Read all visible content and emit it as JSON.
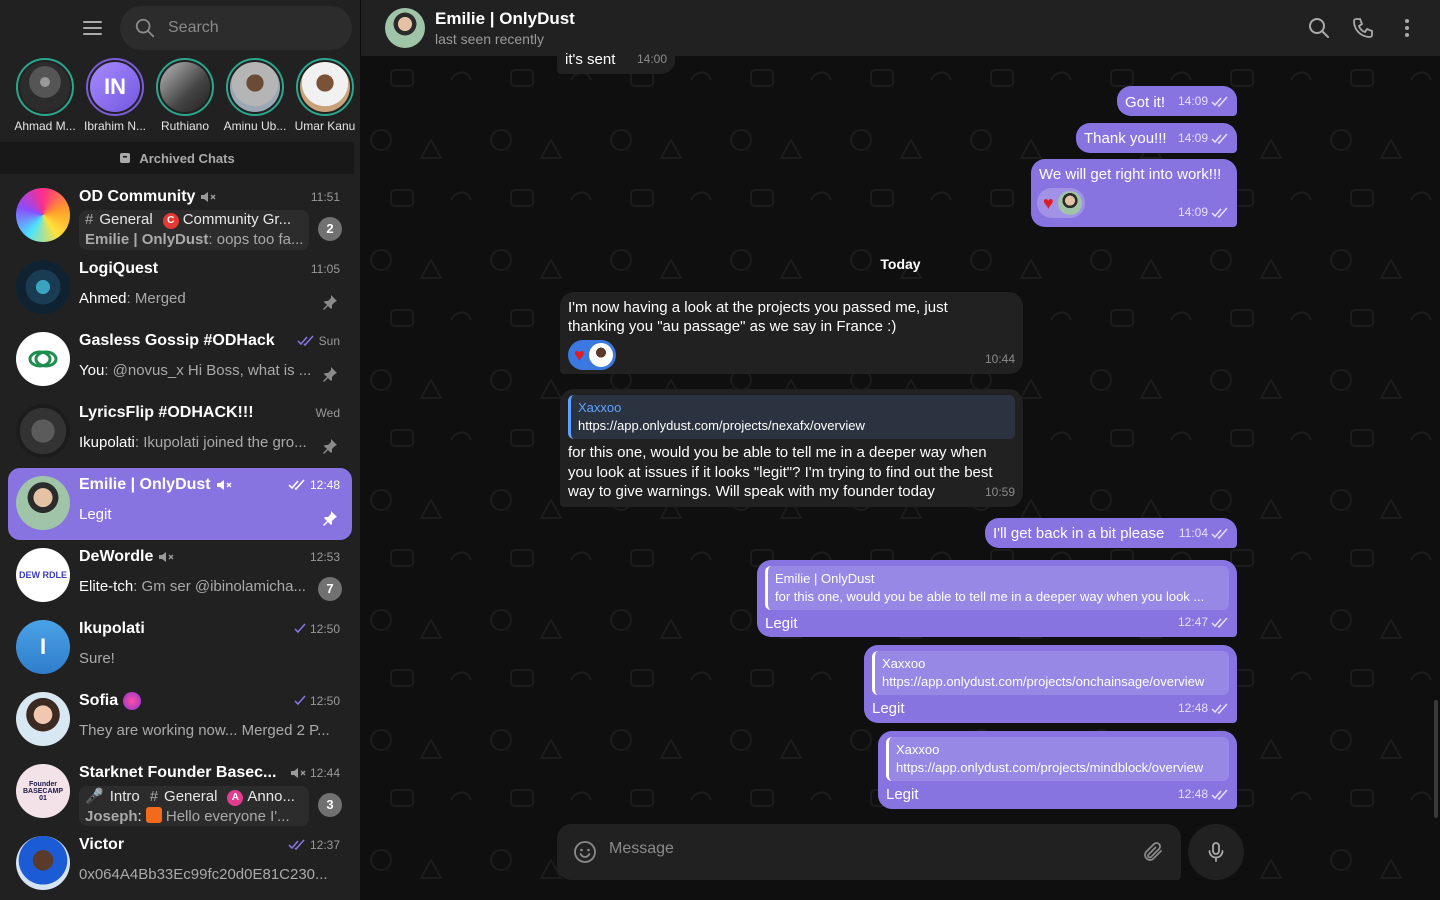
{
  "sidebar": {
    "search_placeholder": "Search",
    "archived_label": "Archived Chats",
    "stories": [
      {
        "name": "Ahmad M...",
        "initials": ""
      },
      {
        "name": "Ibrahim N...",
        "initials": "IN"
      },
      {
        "name": "Ruthiano",
        "initials": ""
      },
      {
        "name": "Aminu Ub...",
        "initials": ""
      },
      {
        "name": "Umar Kanu",
        "initials": ""
      }
    ],
    "chats": [
      {
        "title": "OD Community",
        "time": "11:51",
        "topic_1": "General",
        "topic_2": "Community Gr...",
        "sender": "Emilie | OnlyDust",
        "preview": ": oops too fa...",
        "badge": "2",
        "muted": true
      },
      {
        "title": "LogiQuest",
        "time": "11:05",
        "sender": "Ahmed",
        "preview": ": Merged"
      },
      {
        "title": "Gasless Gossip #ODHack",
        "time": "Sun",
        "sender": "You",
        "preview": ": @novus_x Hi Boss, what is ..."
      },
      {
        "title": "LyricsFlip #ODHACK!!!",
        "time": "Wed",
        "sender": "Ikupolati",
        "preview": ": Ikupolati joined the gro..."
      },
      {
        "title": "Emilie | OnlyDust",
        "time": "12:48",
        "preview": "Legit"
      },
      {
        "title": "DeWordle",
        "time": "12:53",
        "sender": "Elite-tch",
        "preview": ": Gm ser @ibinolamicha...",
        "badge": "7",
        "avatar_text": "DEW RDLE"
      },
      {
        "title": "Ikupolati",
        "time": "12:50",
        "preview": "Sure!",
        "initial": "I"
      },
      {
        "title": "Sofia",
        "time": "12:50",
        "preview": "They are working now... Merged 2 P..."
      },
      {
        "title": "Starknet Founder Basec...",
        "time": "12:44",
        "topic_1": "Intro",
        "topic_2": "General",
        "topic_3": "Anno...",
        "sender": "Joseph",
        "preview": "Hello everyone I'...",
        "badge": "3",
        "avatar_text": "Founder BASECAMP 01"
      },
      {
        "title": "Victor",
        "time": "12:37",
        "preview": "0x064A4Bb33Ec99fc20d0E81C230..."
      }
    ]
  },
  "header": {
    "name": "Emilie | OnlyDust",
    "status": "last seen recently"
  },
  "messages": {
    "m0": {
      "text": "it's sent",
      "time": "14:00"
    },
    "m1": {
      "text": "Got it!",
      "time": "14:09"
    },
    "m2": {
      "text": "Thank you!!!",
      "time": "14:09"
    },
    "m3": {
      "text": "We will get right into work!!!",
      "time": "14:09"
    },
    "day_label": "Today",
    "m4": {
      "text_1": "I'm now having a look at the projects you passed me, just",
      "text_2": "thanking you \"au passage\" as we say in France :)",
      "time": "10:44"
    },
    "m5": {
      "reply_name": "Xaxxoo",
      "reply_text": "https://app.onlydust.com/projects/nexafx/overview",
      "text_1": "for this one, would you be able to tell me in a deeper way when",
      "text_2": "you look at issues if it looks \"legit\"? I'm trying to find out the best",
      "text_3": "way to give warnings. Will speak with my founder today",
      "time": "10:59"
    },
    "m6": {
      "text": "I'll get back in a bit please",
      "time": "11:04"
    },
    "m7": {
      "reply_name": "Emilie | OnlyDust",
      "reply_text": "for this one, would you be able to tell me in a deeper way when you look ...",
      "text": "Legit",
      "time": "12:47"
    },
    "m8": {
      "reply_name": "Xaxxoo",
      "reply_text": "https://app.onlydust.com/projects/onchainsage/overview",
      "text": "Legit",
      "time": "12:48"
    },
    "m9": {
      "reply_name": "Xaxxoo",
      "reply_text": "https://app.onlydust.com/projects/mindblock/overview",
      "text": "Legit",
      "time": "12:48"
    }
  },
  "composer": {
    "placeholder": "Message"
  },
  "colors": {
    "accent": "#8774e1",
    "bubble_in": "#212121",
    "sidebar": "#212121",
    "heart": "#e21b23",
    "story_ring": "#2aa68f"
  },
  "icons": [
    "menu-icon",
    "search-icon",
    "archive-icon",
    "muted-icon",
    "pin-icon",
    "double-check-icon",
    "check-icon",
    "phone-icon",
    "more-icon",
    "emoji-icon",
    "attach-icon",
    "mic-icon",
    "heart-icon"
  ]
}
